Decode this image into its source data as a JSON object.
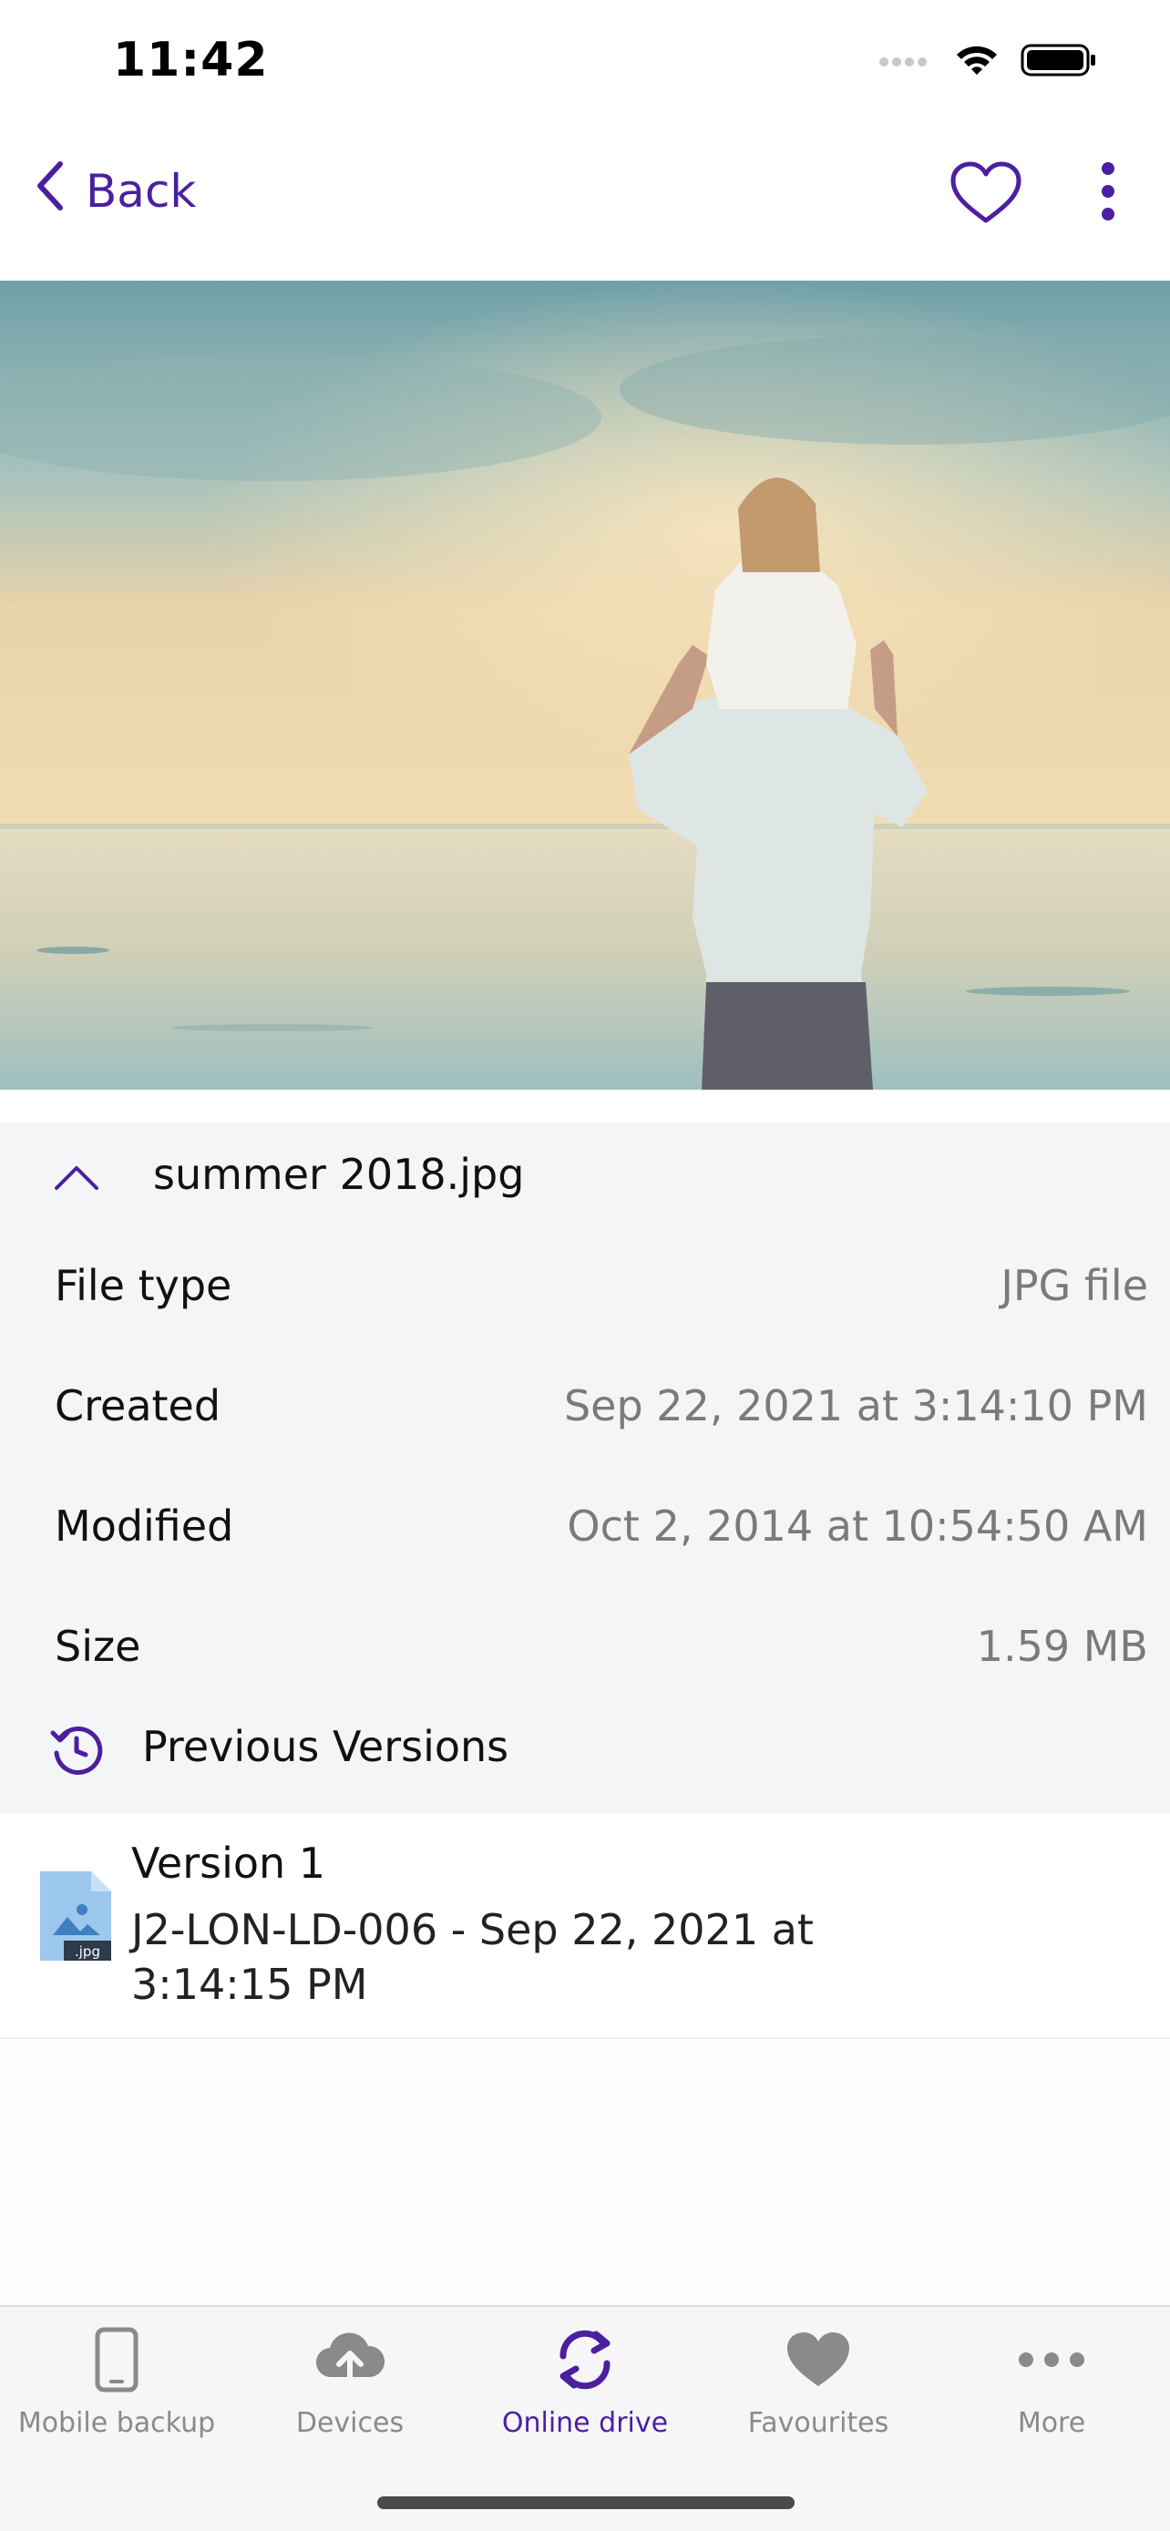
{
  "status_bar": {
    "time": "11:42",
    "icons": [
      "signal-icon",
      "wifi-icon",
      "battery-icon"
    ]
  },
  "nav": {
    "back_label": "Back",
    "icons": [
      "chevron-left-icon",
      "heart-outline-icon",
      "more-vertical-icon"
    ]
  },
  "file": {
    "name": "summer 2018.jpg",
    "details": [
      {
        "label": "File type",
        "value": "JPG file"
      },
      {
        "label": "Created",
        "value": "Sep 22, 2021 at 3:14:10 PM"
      },
      {
        "label": "Modified",
        "value": "Oct 2, 2014 at 10:54:50 AM"
      },
      {
        "label": "Size",
        "value": "1.59 MB"
      }
    ],
    "previous_versions_label": "Previous Versions"
  },
  "versions": [
    {
      "title": "Version 1",
      "subtitle": "J2-LON-LD-006 - Sep 22, 2021 at 3:14:15 PM",
      "file_badge": ".jpg"
    }
  ],
  "tabs": [
    {
      "label": "Mobile backup",
      "icon": "phone-icon",
      "active": false
    },
    {
      "label": "Devices",
      "icon": "cloud-upload-icon",
      "active": false
    },
    {
      "label": "Online drive",
      "icon": "sync-icon",
      "active": true
    },
    {
      "label": "Favourites",
      "icon": "heart-icon",
      "active": false
    },
    {
      "label": "More",
      "icon": "more-horizontal-icon",
      "active": false
    }
  ],
  "colors": {
    "accent": "#4b1fa0",
    "details_background": "#f4f5f7",
    "muted_text": "#7a7a7a",
    "inactive_tab": "#8a8a8a"
  }
}
